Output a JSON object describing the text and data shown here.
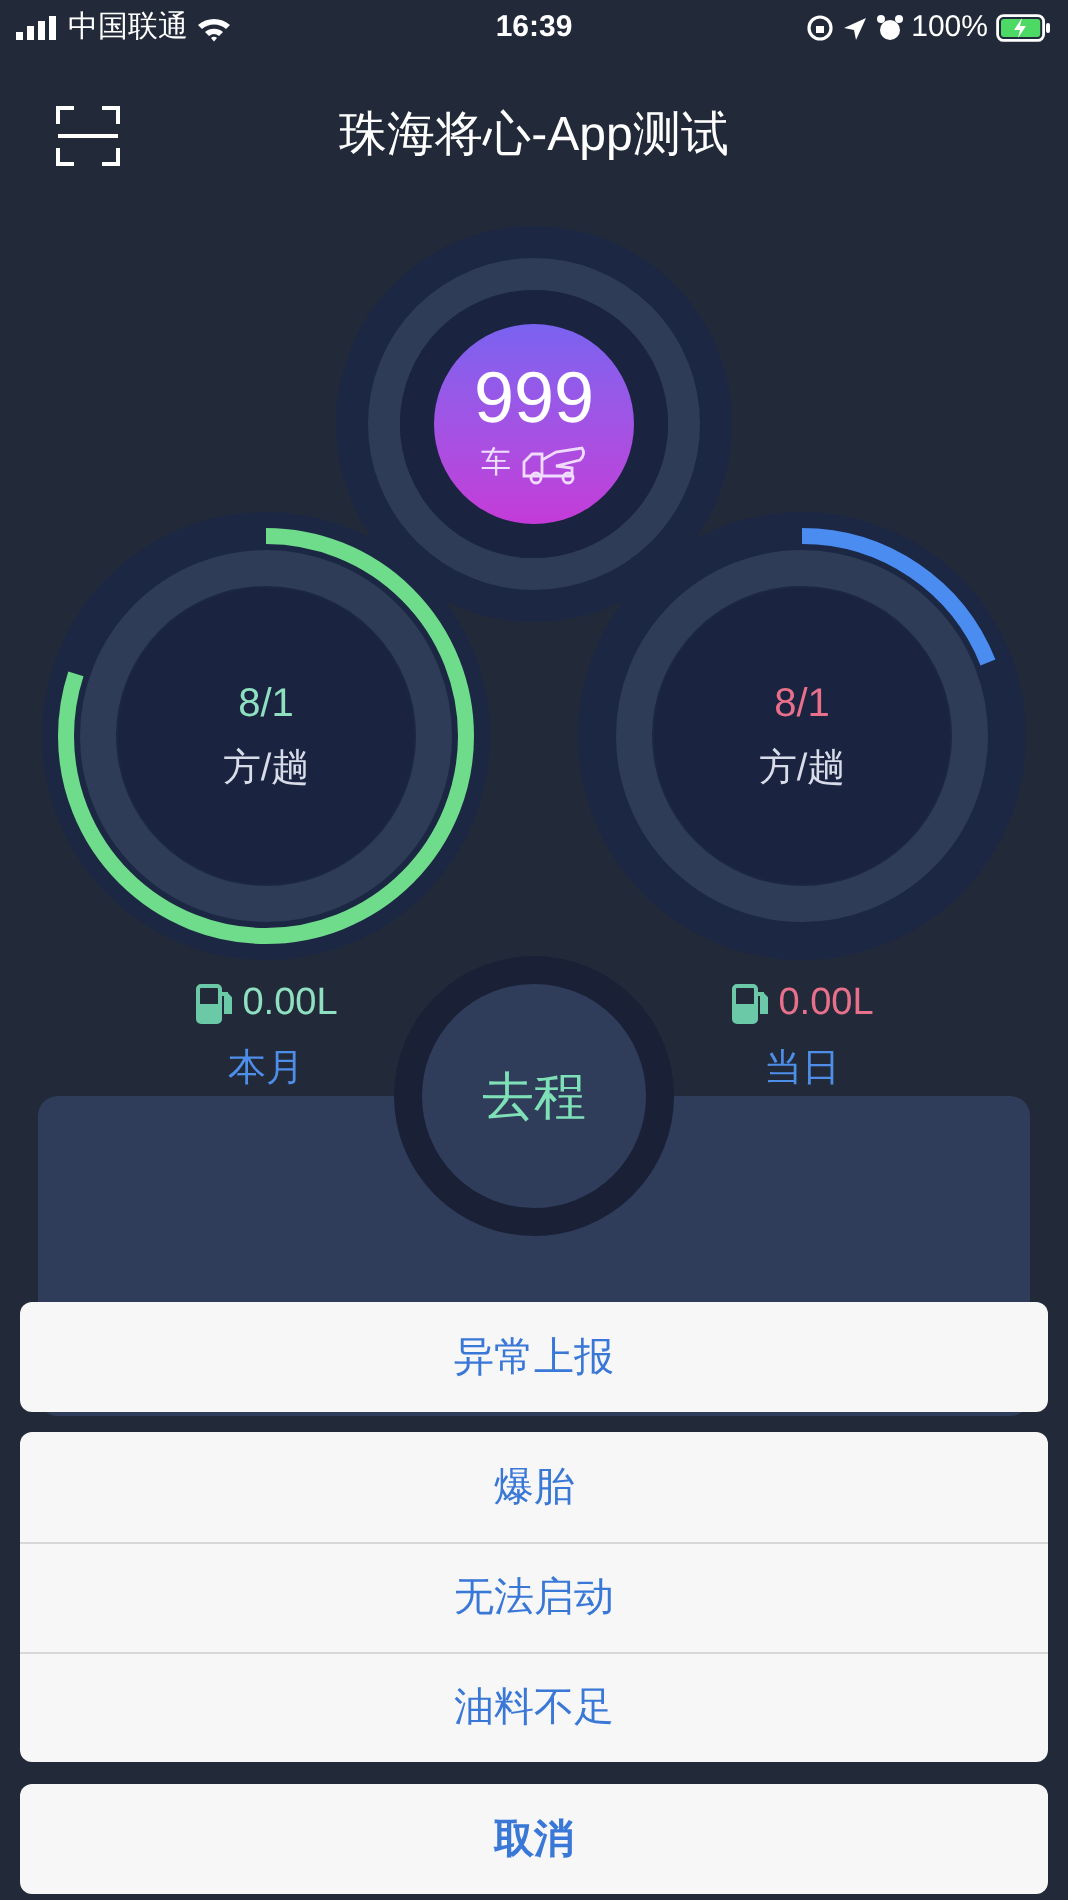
{
  "status_bar": {
    "carrier": "中国联通",
    "time": "16:39",
    "battery": "100%"
  },
  "header": {
    "title": "珠海将心-App测试"
  },
  "vehicle_counter": {
    "value": "999",
    "unit": "车"
  },
  "gauges": [
    {
      "value": "8/1",
      "unit": "方/趟",
      "level": 0.8,
      "color": "#6fdc8c",
      "kind": "positive",
      "fuel": "0.00L",
      "label": "本月"
    },
    {
      "value": "8/1",
      "unit": "方/趟",
      "level": 0.19,
      "color": "#4a8cf0",
      "kind": "negative",
      "fuel": "0.00L",
      "label": "当日"
    }
  ],
  "trip_button": {
    "label": "去程"
  },
  "action_sheet": {
    "title": "异常上报",
    "options": [
      "爆胎",
      "无法启动",
      "油料不足"
    ],
    "cancel": "取消"
  }
}
